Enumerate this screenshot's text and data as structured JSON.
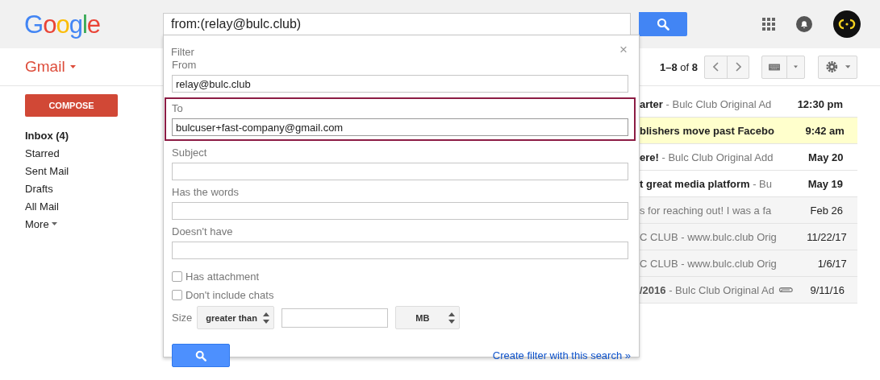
{
  "header": {
    "logo": "Google",
    "search_query": "from:(relay@bulc.club)"
  },
  "toolbar": {
    "app_name": "Gmail",
    "page_info": "**1–8** of **8**"
  },
  "sidebar": {
    "compose": "COMPOSE",
    "items": [
      {
        "label": "Inbox (4)",
        "selected": true,
        "expandable": false
      },
      {
        "label": "Starred",
        "selected": false,
        "expandable": false
      },
      {
        "label": "Sent Mail",
        "selected": false,
        "expandable": false
      },
      {
        "label": "Drafts",
        "selected": false,
        "expandable": false
      },
      {
        "label": "All Mail",
        "selected": false,
        "expandable": false
      },
      {
        "label": "More",
        "selected": false,
        "expandable": true
      }
    ]
  },
  "messages": [
    {
      "subject": "arter",
      "snippet": " - Bulc Club Original Ad",
      "date": "12:30 pm",
      "unread": true,
      "highlighted": false,
      "attachment": false
    },
    {
      "subject": "blishers move past Facebo",
      "date": "9:42 am",
      "unread": true,
      "highlighted": true,
      "attachment": false
    },
    {
      "subject": "ere!",
      "snippet": " - Bulc Club Original Add",
      "date": "May 20",
      "unread": true,
      "highlighted": false,
      "attachment": false
    },
    {
      "subject": "t great media platform",
      "snippet": " - Bu",
      "date": "May 19",
      "unread": true,
      "highlighted": false,
      "attachment": false
    },
    {
      "snippet": "s for reaching out! I was a fa",
      "date": "Feb 26",
      "unread": false,
      "highlighted": false,
      "attachment": false
    },
    {
      "snippet": "C CLUB - www.bulc.club Orig",
      "date": "11/22/17",
      "unread": false,
      "highlighted": false,
      "attachment": false
    },
    {
      "snippet": "C CLUB - www.bulc.club Orig",
      "date": "1/6/17",
      "unread": false,
      "highlighted": false,
      "attachment": false
    },
    {
      "subject": "/2016",
      "snippet": " - Bulc Club Original Ad",
      "date": "9/11/16",
      "unread": false,
      "highlighted": false,
      "attachment": true
    }
  ],
  "filter_popup": {
    "title": "Filter",
    "close": "×",
    "fields": [
      {
        "label": "From",
        "value": "relay@bulc.club",
        "highlighted": false
      },
      {
        "label": "To",
        "value": "bulcuser+fast-company@gmail.com",
        "highlighted": true
      },
      {
        "label": "Subject",
        "highlighted": false
      },
      {
        "label": "Has the words",
        "highlighted": false
      },
      {
        "label": "Doesn't have",
        "highlighted": false
      }
    ],
    "checkboxes": [
      {
        "label": "Has attachment",
        "checked": false
      },
      {
        "label": "Don't include chats",
        "checked": false
      }
    ],
    "size": {
      "label": "Size",
      "operator": "greater than",
      "unit": "MB"
    },
    "create_filter_link": "Create filter with this search »"
  }
}
